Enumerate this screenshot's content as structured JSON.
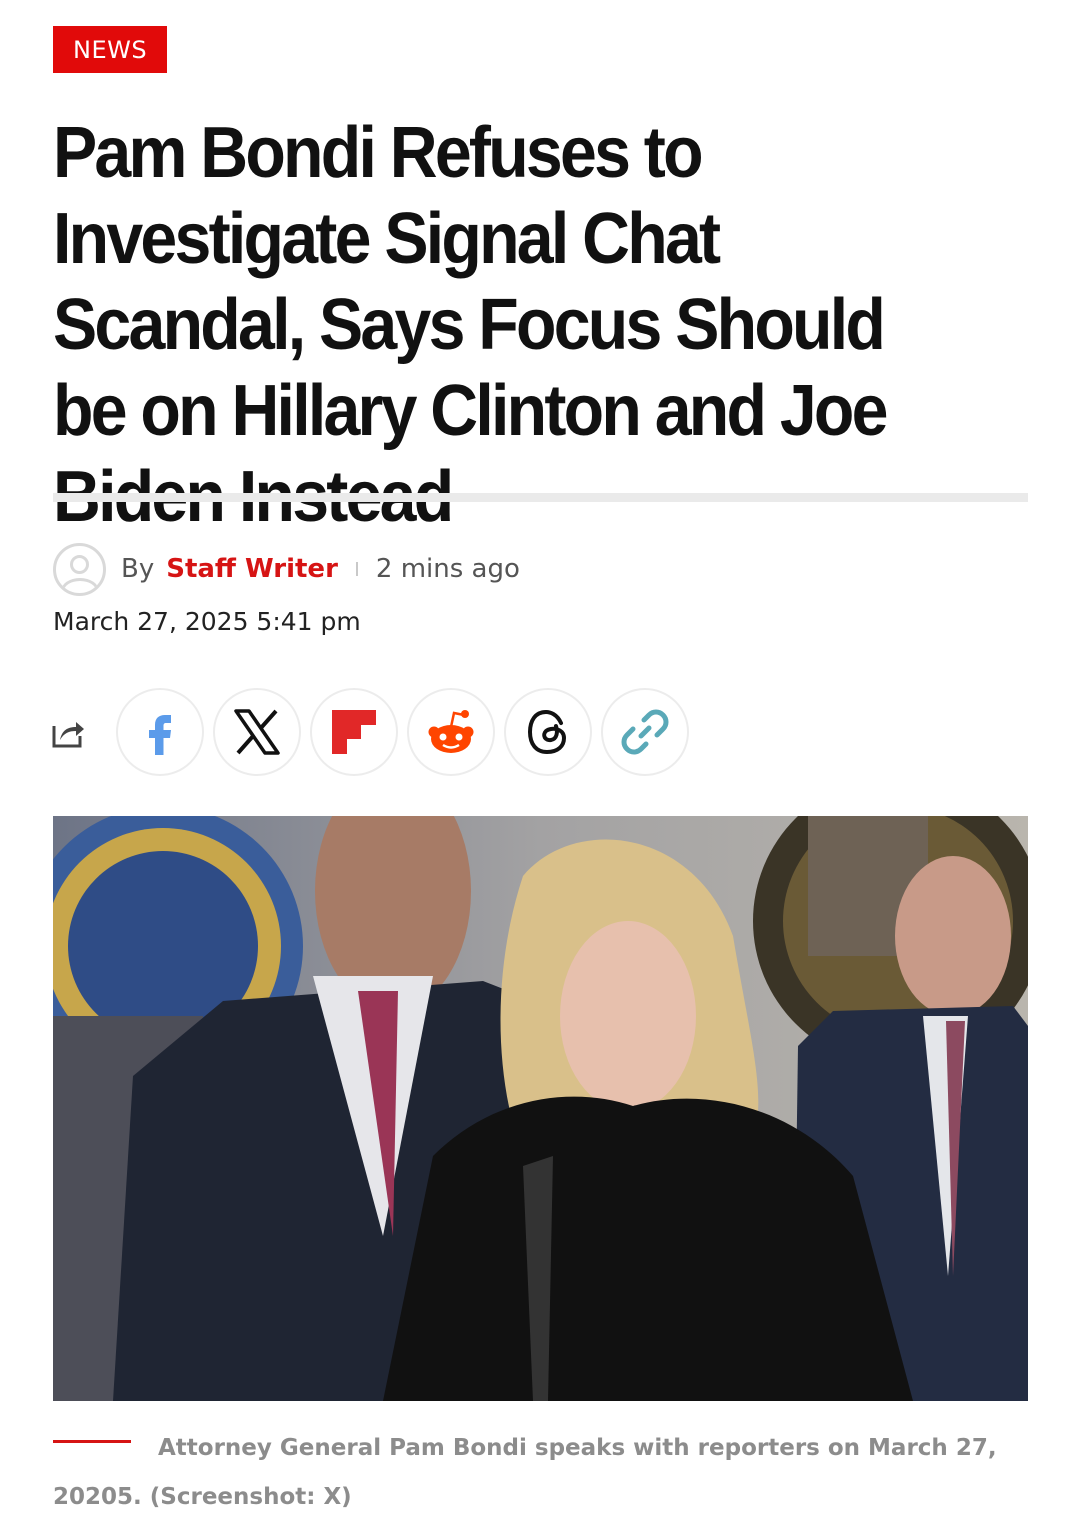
{
  "category": "NEWS",
  "headline": "Pam Bondi Refuses to Investigate Signal Chat Scandal, Says Focus Should be on Hillary Clinton and Joe Biden Instead",
  "byline": {
    "by_label": "By",
    "author": "Staff Writer",
    "time_ago": "2 mins ago",
    "date": "March 27, 2025 5:41 pm"
  },
  "share": {
    "icons": [
      "share-icon",
      "facebook-icon",
      "x-icon",
      "flipboard-icon",
      "reddit-icon",
      "threads-icon",
      "link-icon"
    ]
  },
  "caption": "Attorney General Pam Bondi speaks with reporters on March 27, 20205. (Screenshot: X)",
  "colors": {
    "accent": "#e10a0a",
    "author": "#d61414",
    "facebook": "#4a90e2",
    "flipboard": "#e12828",
    "reddit": "#ff4500",
    "link": "#5aa9b8"
  }
}
